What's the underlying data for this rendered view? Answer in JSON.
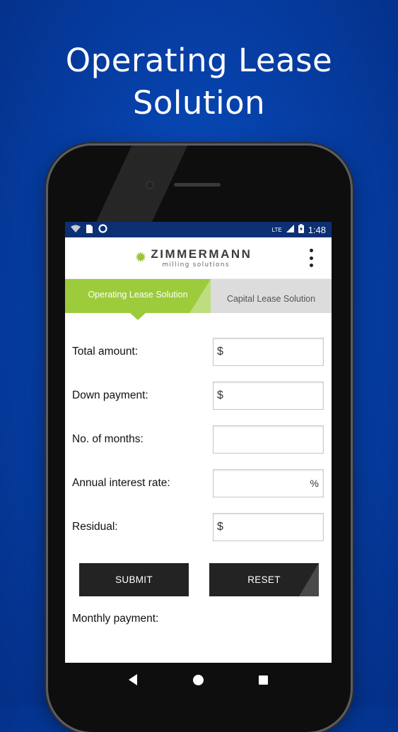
{
  "headline": {
    "line1": "Operating Lease",
    "line2": "Solution"
  },
  "status_bar": {
    "network": "LTE",
    "time": "1:48"
  },
  "app_bar": {
    "logo_name": "ZIMMERMANN",
    "logo_tagline": "milling solutions"
  },
  "tabs": {
    "active": "Operating Lease Solution",
    "inactive": "Capital Lease Solution"
  },
  "form": {
    "fields": [
      {
        "label": "Total amount:",
        "prefix": "$",
        "suffix": "",
        "value": ""
      },
      {
        "label": "Down payment:",
        "prefix": "$",
        "suffix": "",
        "value": ""
      },
      {
        "label": "No. of months:",
        "prefix": "",
        "suffix": "",
        "value": ""
      },
      {
        "label": "Annual interest rate:",
        "prefix": "",
        "suffix": "%",
        "value": ""
      },
      {
        "label": "Residual:",
        "prefix": "$",
        "suffix": "",
        "value": ""
      }
    ],
    "submit_label": "SUBMIT",
    "reset_label": "RESET",
    "result_label": "Monthly payment:"
  },
  "colors": {
    "accent_green": "#9ccb3b",
    "background_blue": "#0640a8",
    "button_dark": "#232323"
  },
  "icons": [
    "wifi-icon",
    "sim-card-icon",
    "sync-icon",
    "battery-icon",
    "more-vert-icon",
    "back-icon",
    "home-icon",
    "recents-icon"
  ]
}
